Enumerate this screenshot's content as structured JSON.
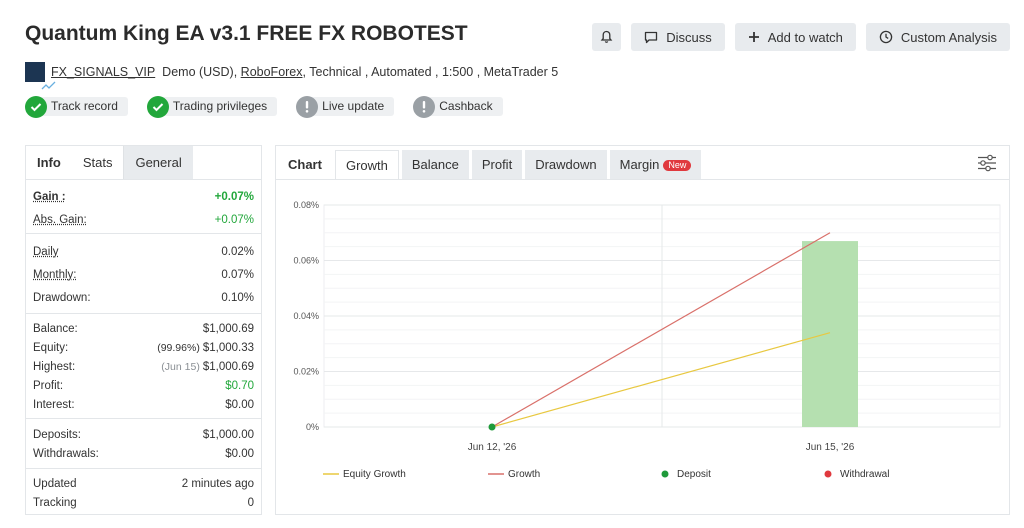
{
  "header": {
    "title": "Quantum King EA v3.1 FREE FX ROBOTEST",
    "buttons": {
      "discuss": "Discuss",
      "add_to_watch": "Add to watch",
      "custom_analysis": "Custom Analysis"
    }
  },
  "account": {
    "owner": "FX_SIGNALS_VIP",
    "type": "Demo (USD),",
    "broker": "RoboForex",
    "details": ", Technical , Automated , 1:500 , MetaTrader 5"
  },
  "badges": [
    {
      "label": "Track record",
      "status": "verified",
      "icon": "check-icon"
    },
    {
      "label": "Trading privileges",
      "status": "verified",
      "icon": "check-icon"
    },
    {
      "label": "Live update",
      "status": "unverified",
      "icon": "exclamation-icon"
    },
    {
      "label": "Cashback",
      "status": "unverified",
      "icon": "exclamation-icon"
    }
  ],
  "left_tabs": [
    "Info",
    "Stats",
    "General"
  ],
  "stats": {
    "gain_label": "Gain :",
    "gain_value": "+0.07%",
    "abs_gain_label": "Abs. Gain:",
    "abs_gain_value": "+0.07%",
    "daily_label": "Daily",
    "daily_value": "0.02%",
    "monthly_label": "Monthly:",
    "monthly_value": "0.07%",
    "drawdown_label": "Drawdown:",
    "drawdown_value": "0.10%",
    "balance_label": "Balance:",
    "balance_value": "$1,000.69",
    "equity_label": "Equity:",
    "equity_note": "(99.96%)",
    "equity_value": "$1,000.33",
    "highest_label": "Highest:",
    "highest_note": "(Jun 15)",
    "highest_value": "$1,000.69",
    "profit_label": "Profit:",
    "profit_value": "$0.70",
    "interest_label": "Interest:",
    "interest_value": "$0.00",
    "deposits_label": "Deposits:",
    "deposits_value": "$1,000.00",
    "withdrawals_label": "Withdrawals:",
    "withdrawals_value": "$0.00",
    "updated_label": "Updated",
    "updated_value": "2 minutes ago",
    "tracking_label": "Tracking",
    "tracking_value": "0"
  },
  "chart_tabs": {
    "chart": "Chart",
    "growth": "Growth",
    "balance": "Balance",
    "profit": "Profit",
    "drawdown": "Drawdown",
    "margin": "Margin",
    "new_badge": "New"
  },
  "chart_data": {
    "type": "line",
    "x": [
      "Jun 12, '26",
      "Jun 15, '26"
    ],
    "ylim": [
      0,
      0.08
    ],
    "y_ticks": [
      "0%",
      "0.02%",
      "0.04%",
      "0.06%",
      "0.08%"
    ],
    "y_tick_values": [
      0,
      0.02,
      0.04,
      0.06,
      0.08
    ],
    "series": [
      {
        "name": "Equity Growth",
        "kind": "line",
        "color": "#e8c840",
        "values": [
          0,
          0.034
        ]
      },
      {
        "name": "Growth",
        "kind": "line",
        "color": "#d9706a",
        "values": [
          0,
          0.07
        ]
      },
      {
        "name": "Growth",
        "kind": "bar",
        "color": "#b5e0b0",
        "values": [
          null,
          0.067
        ]
      },
      {
        "name": "Deposit",
        "kind": "marker",
        "color": "#1f9a3a",
        "values": [
          0,
          null
        ]
      },
      {
        "name": "Withdrawal",
        "kind": "marker",
        "color": "#e0393e",
        "values": [
          null,
          null
        ]
      }
    ],
    "legend": [
      "Equity Growth",
      "Growth",
      "Deposit",
      "Withdrawal"
    ],
    "legend_position": "bottom",
    "grid": true
  },
  "colors": {
    "accent_green": "#22a73b",
    "badge_grey": "#9aa0a5",
    "button_bg": "#e8ebee",
    "new_red": "#e0393e"
  }
}
